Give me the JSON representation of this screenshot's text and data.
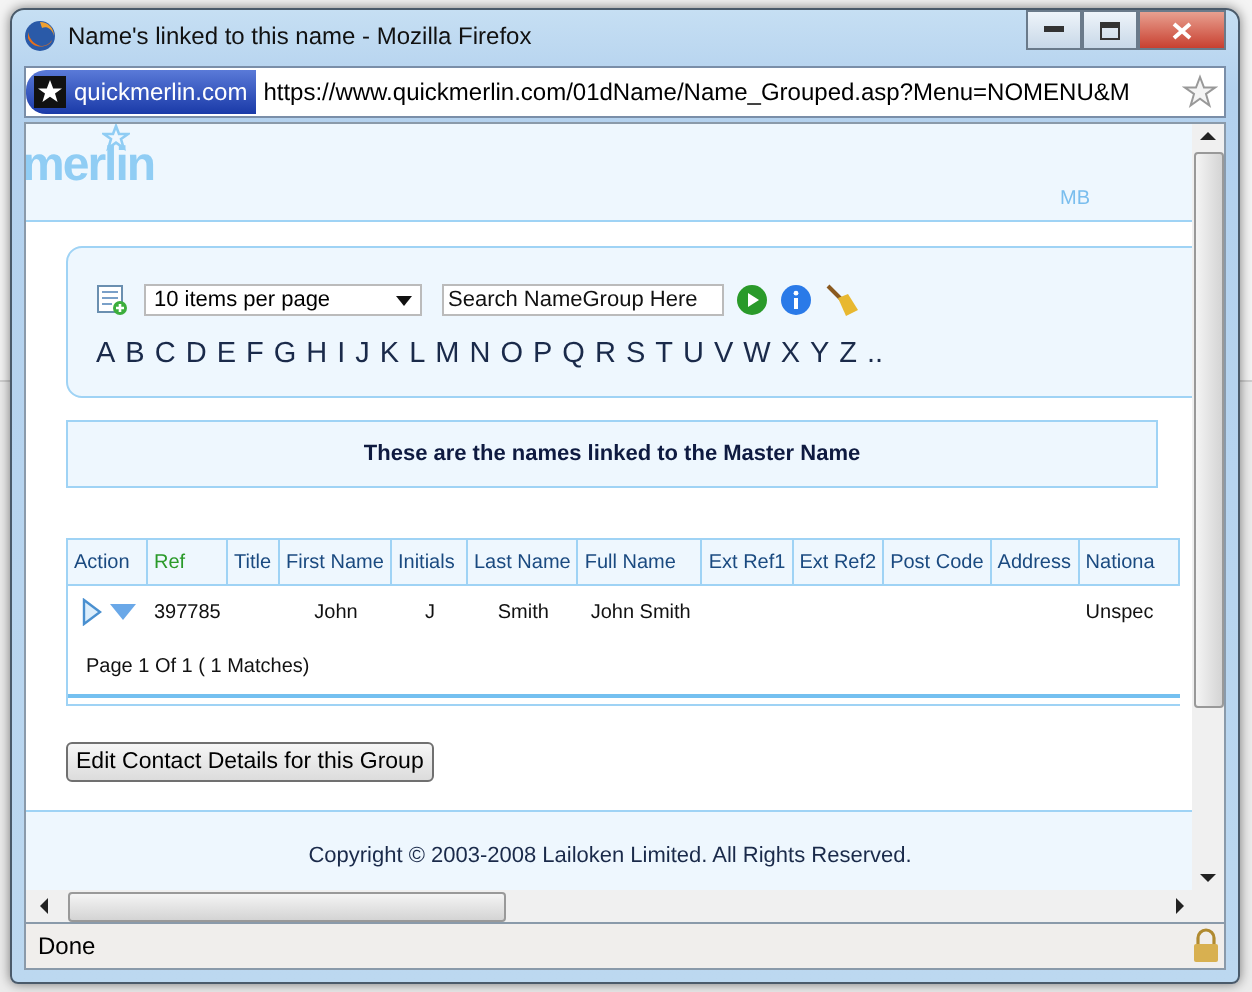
{
  "window": {
    "title": "Name's linked to this name - Mozilla Firefox"
  },
  "address_bar": {
    "site": "quickmerlin.com",
    "url": "https://www.quickmerlin.com/01dName/Name_Grouped.asp?Menu=NOMENU&M"
  },
  "header": {
    "logo": "merlin",
    "user": "MB"
  },
  "toolbar": {
    "page_size": "10 items per page",
    "search": {
      "placeholder": "Search NameGroup Here"
    },
    "letters": [
      "A",
      "B",
      "C",
      "D",
      "E",
      "F",
      "G",
      "H",
      "I",
      "J",
      "K",
      "L",
      "M",
      "N",
      "O",
      "P",
      "Q",
      "R",
      "S",
      "T",
      "U",
      "V",
      "W",
      "X",
      "Y",
      "Z",
      ".."
    ]
  },
  "banner": "These are the names linked to the Master Name",
  "table": {
    "columns": [
      {
        "label": "Action",
        "sorted": false
      },
      {
        "label": "Ref",
        "sorted": true
      },
      {
        "label": "Title",
        "sorted": false
      },
      {
        "label": "First Name",
        "sorted": false
      },
      {
        "label": "Initials",
        "sorted": false
      },
      {
        "label": "Last Name",
        "sorted": false
      },
      {
        "label": "Full Name",
        "sorted": false
      },
      {
        "label": "Ext Ref1",
        "sorted": false
      },
      {
        "label": "Ext Ref2",
        "sorted": false
      },
      {
        "label": "Post Code",
        "sorted": false
      },
      {
        "label": "Address",
        "sorted": false
      },
      {
        "label": "Nationa",
        "sorted": false
      }
    ],
    "rows": [
      {
        "cells": [
          "",
          "397785",
          "",
          "John",
          "J",
          "Smith",
          "John Smith",
          "",
          "",
          "",
          "",
          "Unspec"
        ]
      }
    ],
    "pager": "Page 1 Of 1 ( 1 Matches)"
  },
  "edit_button": "Edit Contact Details for this Group",
  "footer": "Copyright © 2003-2008 Lailoken Limited. All Rights Reserved.",
  "status_bar": {
    "text": "Done"
  }
}
